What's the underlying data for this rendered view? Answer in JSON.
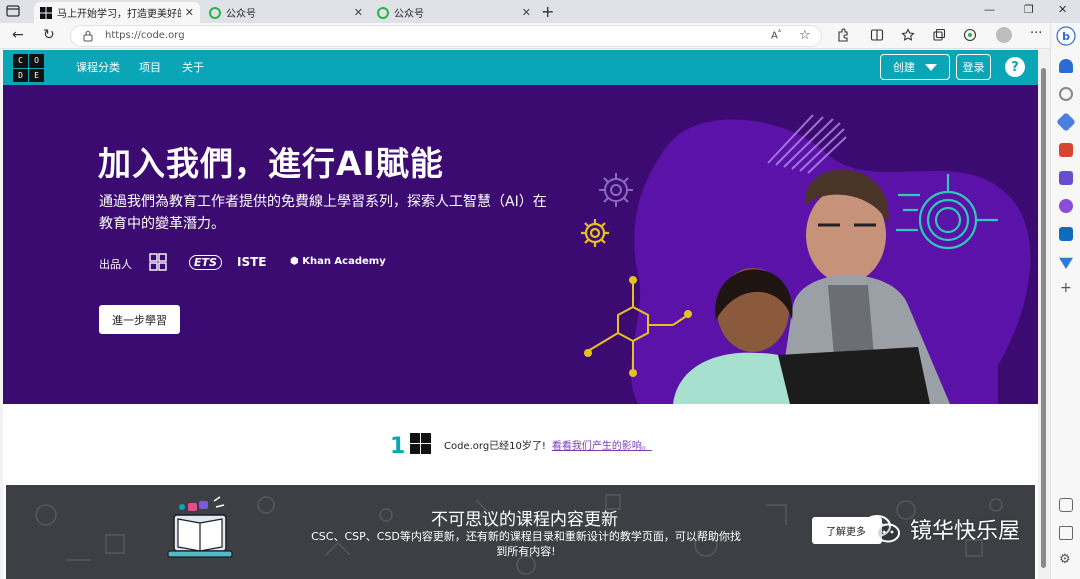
{
  "browser": {
    "tabs": [
      {
        "title": "马上开始学习，打造更美好的明天",
        "active": true
      },
      {
        "title": "公众号",
        "active": false
      },
      {
        "title": "公众号",
        "active": false
      }
    ],
    "url": "https://code.org"
  },
  "site": {
    "logo_letters": [
      "C",
      "O",
      "D",
      "E"
    ],
    "nav": [
      "课程分类",
      "项目",
      "关于"
    ],
    "create_label": "创建",
    "login_label": "登录",
    "help_label": "?"
  },
  "hero": {
    "title": "加入我們，進行AI賦能",
    "subtitle": "通過我們為教育工作者提供的免費線上學習系列，探索人工智慧（AI）在教育中的變革潛力。",
    "byline": "出品人",
    "partners": [
      "ETS",
      "ISTE",
      "Khan Academy"
    ],
    "cta": "進一步學習"
  },
  "anniversary": {
    "text": "Code.org已经10岁了!",
    "link": "看看我们产生的影响。"
  },
  "banner": {
    "title": "不可思议的课程内容更新",
    "description": "CSC、CSP、CSD等内容更新，还有新的课程目录和重新设计的教学页面，可以帮助你找到所有内容!",
    "button": "了解更多"
  },
  "watermark": "镜华快乐屋",
  "colors": {
    "header_teal": "#0aa6b7",
    "hero_purple": "#3c0b72",
    "banner_gray": "#3d3f45",
    "link_purple": "#7a3db8"
  }
}
